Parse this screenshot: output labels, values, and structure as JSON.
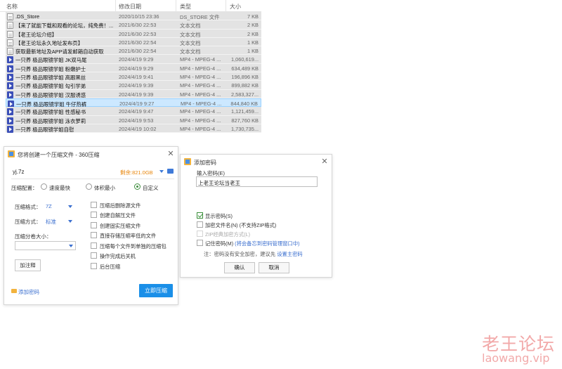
{
  "file_list": {
    "columns": {
      "name": "名称",
      "date": "修改日期",
      "type": "类型",
      "size": "大小"
    },
    "rows": [
      {
        "icon": "doc",
        "name": ".DS_Store",
        "date": "2020/10/15 23:36",
        "type": "DS_STORE 文件",
        "size": "7 KB"
      },
      {
        "icon": "doc",
        "name": "【来了就能下载和观看的论坛，纯免费！...",
        "date": "2021/6/30 22:53",
        "type": "文本文档",
        "size": "2 KB"
      },
      {
        "icon": "doc",
        "name": "【老王论坛介绍】",
        "date": "2021/6/30 22:53",
        "type": "文本文档",
        "size": "2 KB"
      },
      {
        "icon": "doc",
        "name": "【老王论坛永久地址发布页】",
        "date": "2021/6/30 22:54",
        "type": "文本文档",
        "size": "1 KB"
      },
      {
        "icon": "doc",
        "name": "获取最新地址及APP请发邮箱自动获取",
        "date": "2021/6/30 22:54",
        "type": "文本文档",
        "size": "1 KB"
      },
      {
        "icon": "video",
        "name": "一只养 极品眼镜学姐 JK双马尾",
        "date": "2024/4/19 9:29",
        "type": "MP4 - MPEG-4 ...",
        "size": "1,060,619..."
      },
      {
        "icon": "video",
        "name": "一只养 极品眼镜学姐 粉嫩护士",
        "date": "2024/4/19 9:29",
        "type": "MP4 - MPEG-4 ...",
        "size": "634,489 KB"
      },
      {
        "icon": "video",
        "name": "一只养 极品眼镜学姐 高跟黑丝",
        "date": "2024/4/19 9:41",
        "type": "MP4 - MPEG-4 ...",
        "size": "196,896 KB"
      },
      {
        "icon": "video",
        "name": "一只养 极品眼镜学姐 勾引学弟",
        "date": "2024/4/19 9:39",
        "type": "MP4 - MPEG-4 ...",
        "size": "899,882 KB"
      },
      {
        "icon": "video",
        "name": "一只养 极品眼镜学姐 汉服诱惑",
        "date": "2024/4/19 9:39",
        "type": "MP4 - MPEG-4 ...",
        "size": "2,583,327..."
      },
      {
        "icon": "video",
        "name": "一只养 极品眼镜学姐 牛仔热裤",
        "date": "2024/4/19 9:27",
        "type": "MP4 - MPEG-4 ...",
        "size": "844,840 KB",
        "selected": true
      },
      {
        "icon": "video",
        "name": "一只养 极品眼镜学姐 性感秘书",
        "date": "2024/4/19 9:47",
        "type": "MP4 - MPEG-4 ...",
        "size": "1,121,459..."
      },
      {
        "icon": "video",
        "name": "一只养 极品眼镜学姐 泳衣萝莉",
        "date": "2024/4/19 9:53",
        "type": "MP4 - MPEG-4 ...",
        "size": "827,760 KB"
      },
      {
        "icon": "video",
        "name": "一只养 极品眼镜学姐自慰",
        "date": "2024/4/19 10:02",
        "type": "MP4 - MPEG-4 ...",
        "size": "1,730,735..."
      }
    ]
  },
  "archive_dialog": {
    "title": "您将创建一个压缩文件 - 360压缩",
    "close": "✕",
    "path": "yj.7z",
    "free_space": "剩余:821.0GB",
    "config_label": "压缩配置：",
    "modes": [
      "速度最快",
      "体积最小",
      "自定义"
    ],
    "format_label": "压缩格式：",
    "format_value": "7Z",
    "method_label": "压缩方式：",
    "method_value": "标准",
    "volume_label": "压缩分卷大小：",
    "note_button": "加注释",
    "options": [
      "压缩后删除源文件",
      "创建自解压文件",
      "创建固实压缩文件",
      "直接存储压缩率低的文件",
      "压缩每个文件到单独的压缩包",
      "操作完成后关机",
      "后台压缩"
    ],
    "add_password": "添加密码",
    "start_button": "立即压缩"
  },
  "password_dialog": {
    "title": "添加密码",
    "close": "✕",
    "input_label": "输入密码(E)",
    "password_value": "上老王论坛当老王",
    "show_password": "显示密码(S)",
    "encrypt_names": "加密文件名(N) (不支持ZIP格式)",
    "zip_classic": "ZIP经典加密方式(L)",
    "remember_pre": "记住密码(M) ",
    "remember_link": "(将会备忘到密码管理窗口中)",
    "tip_pre": "注：密码没有安全加密，建议先 ",
    "tip_link": "设置主密码",
    "ok": "确认",
    "cancel": "取消"
  },
  "watermark": {
    "cn": "老王论坛",
    "en": "laowang.vip"
  }
}
